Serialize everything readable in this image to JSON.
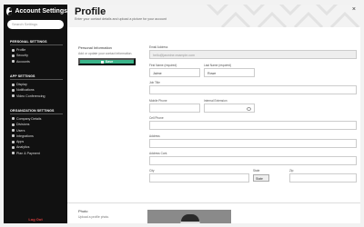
{
  "sidebar": {
    "title": "Account Settings",
    "search_placeholder": "Search Settings",
    "sections": [
      {
        "label": "PERSONAL SETTINGS",
        "items": [
          "Profile",
          "Security",
          "Accounts"
        ]
      },
      {
        "label": "APP SETTINGS",
        "items": [
          "Display",
          "Notifications",
          "Video Conferencing"
        ]
      },
      {
        "label": "ORGANIZATION SETTINGS",
        "items": [
          "Company Details",
          "Divisions",
          "Users",
          "Integrations",
          "Apps",
          "Analytics",
          "Plan & Payment"
        ]
      }
    ],
    "logout": "Log Out"
  },
  "header": {
    "title": "Profile",
    "subtitle": "Enter your contact details and upload a picture for your account",
    "close_glyph": "×"
  },
  "personal": {
    "heading": "Personal Information",
    "description": "Add or update your contact information.",
    "save_label": "Save"
  },
  "form": {
    "email_label": "Email Address",
    "email_value": "hello@jasmine.example.com",
    "first_name_label": "First Name (required)",
    "first_name_value": "Jaime",
    "last_name_label": "Last Name (required)",
    "last_name_value": "Rowe",
    "job_title_label": "Job Title",
    "mobile_label": "Mobile Phone",
    "extension_label": "Internal Extension",
    "cell_label": "Cell Phone",
    "address_label": "Address",
    "address_cont_label": "Address Cont.",
    "city_label": "City",
    "state_label": "State",
    "state_value": "State",
    "zip_label": "Zip"
  },
  "photo": {
    "heading": "Photo",
    "description": "Upload a profile photo."
  },
  "colors": {
    "accent": "#3bb58a",
    "sidebar_bg": "#111111",
    "logout": "#e04040"
  }
}
